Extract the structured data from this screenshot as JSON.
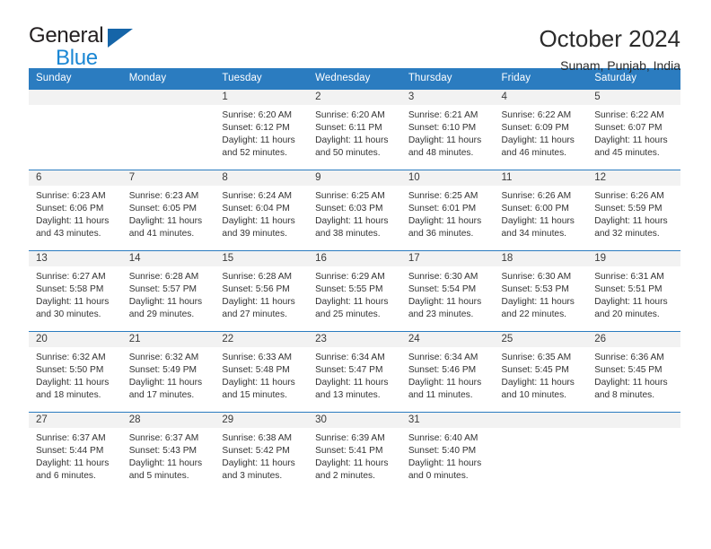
{
  "brand": {
    "word_one": "General",
    "word_two": "Blue",
    "triangle_color": "#1665a8",
    "blue_color": "#1b87d4",
    "dark_color": "#231f20"
  },
  "header": {
    "title": "October 2024",
    "subtitle": "Sunam, Punjab, India"
  },
  "theme": {
    "header_blue": "#2b7cc0",
    "daynum_band": "#f2f2f2",
    "text": "#333333"
  },
  "weekdays": [
    "Sunday",
    "Monday",
    "Tuesday",
    "Wednesday",
    "Thursday",
    "Friday",
    "Saturday"
  ],
  "weeks": [
    [
      {
        "day": ""
      },
      {
        "day": ""
      },
      {
        "day": "1",
        "sunrise": "Sunrise: 6:20 AM",
        "sunset": "Sunset: 6:12 PM",
        "daylight1": "Daylight: 11 hours",
        "daylight2": "and 52 minutes."
      },
      {
        "day": "2",
        "sunrise": "Sunrise: 6:20 AM",
        "sunset": "Sunset: 6:11 PM",
        "daylight1": "Daylight: 11 hours",
        "daylight2": "and 50 minutes."
      },
      {
        "day": "3",
        "sunrise": "Sunrise: 6:21 AM",
        "sunset": "Sunset: 6:10 PM",
        "daylight1": "Daylight: 11 hours",
        "daylight2": "and 48 minutes."
      },
      {
        "day": "4",
        "sunrise": "Sunrise: 6:22 AM",
        "sunset": "Sunset: 6:09 PM",
        "daylight1": "Daylight: 11 hours",
        "daylight2": "and 46 minutes."
      },
      {
        "day": "5",
        "sunrise": "Sunrise: 6:22 AM",
        "sunset": "Sunset: 6:07 PM",
        "daylight1": "Daylight: 11 hours",
        "daylight2": "and 45 minutes."
      }
    ],
    [
      {
        "day": "6",
        "sunrise": "Sunrise: 6:23 AM",
        "sunset": "Sunset: 6:06 PM",
        "daylight1": "Daylight: 11 hours",
        "daylight2": "and 43 minutes."
      },
      {
        "day": "7",
        "sunrise": "Sunrise: 6:23 AM",
        "sunset": "Sunset: 6:05 PM",
        "daylight1": "Daylight: 11 hours",
        "daylight2": "and 41 minutes."
      },
      {
        "day": "8",
        "sunrise": "Sunrise: 6:24 AM",
        "sunset": "Sunset: 6:04 PM",
        "daylight1": "Daylight: 11 hours",
        "daylight2": "and 39 minutes."
      },
      {
        "day": "9",
        "sunrise": "Sunrise: 6:25 AM",
        "sunset": "Sunset: 6:03 PM",
        "daylight1": "Daylight: 11 hours",
        "daylight2": "and 38 minutes."
      },
      {
        "day": "10",
        "sunrise": "Sunrise: 6:25 AM",
        "sunset": "Sunset: 6:01 PM",
        "daylight1": "Daylight: 11 hours",
        "daylight2": "and 36 minutes."
      },
      {
        "day": "11",
        "sunrise": "Sunrise: 6:26 AM",
        "sunset": "Sunset: 6:00 PM",
        "daylight1": "Daylight: 11 hours",
        "daylight2": "and 34 minutes."
      },
      {
        "day": "12",
        "sunrise": "Sunrise: 6:26 AM",
        "sunset": "Sunset: 5:59 PM",
        "daylight1": "Daylight: 11 hours",
        "daylight2": "and 32 minutes."
      }
    ],
    [
      {
        "day": "13",
        "sunrise": "Sunrise: 6:27 AM",
        "sunset": "Sunset: 5:58 PM",
        "daylight1": "Daylight: 11 hours",
        "daylight2": "and 30 minutes."
      },
      {
        "day": "14",
        "sunrise": "Sunrise: 6:28 AM",
        "sunset": "Sunset: 5:57 PM",
        "daylight1": "Daylight: 11 hours",
        "daylight2": "and 29 minutes."
      },
      {
        "day": "15",
        "sunrise": "Sunrise: 6:28 AM",
        "sunset": "Sunset: 5:56 PM",
        "daylight1": "Daylight: 11 hours",
        "daylight2": "and 27 minutes."
      },
      {
        "day": "16",
        "sunrise": "Sunrise: 6:29 AM",
        "sunset": "Sunset: 5:55 PM",
        "daylight1": "Daylight: 11 hours",
        "daylight2": "and 25 minutes."
      },
      {
        "day": "17",
        "sunrise": "Sunrise: 6:30 AM",
        "sunset": "Sunset: 5:54 PM",
        "daylight1": "Daylight: 11 hours",
        "daylight2": "and 23 minutes."
      },
      {
        "day": "18",
        "sunrise": "Sunrise: 6:30 AM",
        "sunset": "Sunset: 5:53 PM",
        "daylight1": "Daylight: 11 hours",
        "daylight2": "and 22 minutes."
      },
      {
        "day": "19",
        "sunrise": "Sunrise: 6:31 AM",
        "sunset": "Sunset: 5:51 PM",
        "daylight1": "Daylight: 11 hours",
        "daylight2": "and 20 minutes."
      }
    ],
    [
      {
        "day": "20",
        "sunrise": "Sunrise: 6:32 AM",
        "sunset": "Sunset: 5:50 PM",
        "daylight1": "Daylight: 11 hours",
        "daylight2": "and 18 minutes."
      },
      {
        "day": "21",
        "sunrise": "Sunrise: 6:32 AM",
        "sunset": "Sunset: 5:49 PM",
        "daylight1": "Daylight: 11 hours",
        "daylight2": "and 17 minutes."
      },
      {
        "day": "22",
        "sunrise": "Sunrise: 6:33 AM",
        "sunset": "Sunset: 5:48 PM",
        "daylight1": "Daylight: 11 hours",
        "daylight2": "and 15 minutes."
      },
      {
        "day": "23",
        "sunrise": "Sunrise: 6:34 AM",
        "sunset": "Sunset: 5:47 PM",
        "daylight1": "Daylight: 11 hours",
        "daylight2": "and 13 minutes."
      },
      {
        "day": "24",
        "sunrise": "Sunrise: 6:34 AM",
        "sunset": "Sunset: 5:46 PM",
        "daylight1": "Daylight: 11 hours",
        "daylight2": "and 11 minutes."
      },
      {
        "day": "25",
        "sunrise": "Sunrise: 6:35 AM",
        "sunset": "Sunset: 5:45 PM",
        "daylight1": "Daylight: 11 hours",
        "daylight2": "and 10 minutes."
      },
      {
        "day": "26",
        "sunrise": "Sunrise: 6:36 AM",
        "sunset": "Sunset: 5:45 PM",
        "daylight1": "Daylight: 11 hours",
        "daylight2": "and 8 minutes."
      }
    ],
    [
      {
        "day": "27",
        "sunrise": "Sunrise: 6:37 AM",
        "sunset": "Sunset: 5:44 PM",
        "daylight1": "Daylight: 11 hours",
        "daylight2": "and 6 minutes."
      },
      {
        "day": "28",
        "sunrise": "Sunrise: 6:37 AM",
        "sunset": "Sunset: 5:43 PM",
        "daylight1": "Daylight: 11 hours",
        "daylight2": "and 5 minutes."
      },
      {
        "day": "29",
        "sunrise": "Sunrise: 6:38 AM",
        "sunset": "Sunset: 5:42 PM",
        "daylight1": "Daylight: 11 hours",
        "daylight2": "and 3 minutes."
      },
      {
        "day": "30",
        "sunrise": "Sunrise: 6:39 AM",
        "sunset": "Sunset: 5:41 PM",
        "daylight1": "Daylight: 11 hours",
        "daylight2": "and 2 minutes."
      },
      {
        "day": "31",
        "sunrise": "Sunrise: 6:40 AM",
        "sunset": "Sunset: 5:40 PM",
        "daylight1": "Daylight: 11 hours",
        "daylight2": "and 0 minutes."
      },
      {
        "day": ""
      },
      {
        "day": ""
      }
    ]
  ]
}
